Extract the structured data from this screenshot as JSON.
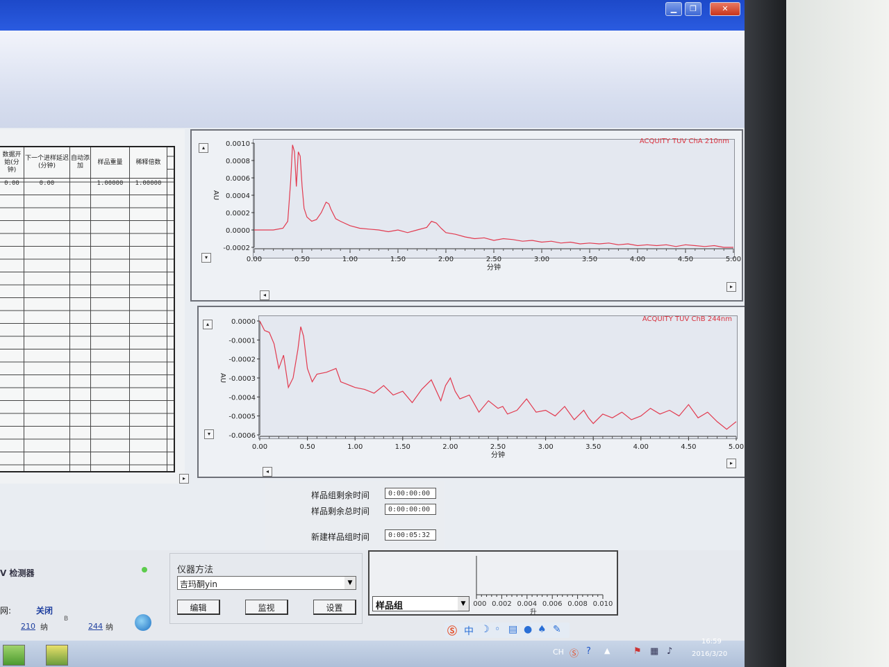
{
  "window": {
    "minimize_symbol": "▁",
    "restore_symbol": "❐",
    "close_symbol": "✕"
  },
  "table": {
    "headers": [
      "数据开始(分钟)",
      "下一个进样延迟(分钟)",
      "自动添加",
      "样品重量",
      "稀释倍数"
    ],
    "row1": [
      "0.00",
      "0.00",
      "",
      "1.00000",
      "1.00000"
    ]
  },
  "charts": [
    {
      "title": "ACQUITY TUV ChA 210nm",
      "ylabel": "AU",
      "xlabel": "分钟",
      "yticks": [
        "0.0010",
        "0.0008",
        "0.0006",
        "0.0004",
        "0.0002",
        "0.0000",
        "-0.0002"
      ],
      "xticks": [
        "0.00",
        "0.50",
        "1.00",
        "1.50",
        "2.00",
        "2.50",
        "3.00",
        "3.50",
        "4.00",
        "4.50",
        "5.00"
      ]
    },
    {
      "title": "ACQUITY TUV ChB 244nm",
      "ylabel": "AU",
      "xlabel": "分钟",
      "yticks": [
        "0.0000",
        "-0.0001",
        "-0.0002",
        "-0.0003",
        "-0.0004",
        "-0.0005",
        "-0.0006"
      ],
      "xticks": [
        "0.00",
        "0.50",
        "1.00",
        "1.50",
        "2.00",
        "2.50",
        "3.00",
        "3.50",
        "4.00",
        "4.50",
        "5.00"
      ]
    }
  ],
  "chart_data": [
    {
      "type": "line",
      "title": "ACQUITY TUV ChA 210nm",
      "xlabel": "分钟",
      "ylabel": "AU",
      "xlim": [
        0,
        5
      ],
      "ylim": [
        -0.0002,
        0.001
      ],
      "series": [
        {
          "color": "#e23a4f",
          "x": [
            0.0,
            0.2,
            0.3,
            0.35,
            0.38,
            0.4,
            0.42,
            0.44,
            0.46,
            0.48,
            0.5,
            0.52,
            0.55,
            0.6,
            0.65,
            0.7,
            0.75,
            0.78,
            0.8,
            0.85,
            0.9,
            1.0,
            1.1,
            1.2,
            1.3,
            1.4,
            1.5,
            1.6,
            1.7,
            1.8,
            1.85,
            1.9,
            1.95,
            2.0,
            2.1,
            2.2,
            2.3,
            2.4,
            2.5,
            2.6,
            2.7,
            2.8,
            2.9,
            3.0,
            3.1,
            3.2,
            3.3,
            3.4,
            3.5,
            3.6,
            3.7,
            3.8,
            3.9,
            4.0,
            4.1,
            4.2,
            4.3,
            4.4,
            4.5,
            4.6,
            4.7,
            4.8,
            4.9,
            5.0
          ],
          "values": [
            0.0,
            0.0,
            2e-05,
            0.0001,
            0.00055,
            0.00098,
            0.0009,
            0.0005,
            0.0009,
            0.00085,
            0.0005,
            0.00025,
            0.00015,
            0.0001,
            0.00012,
            0.0002,
            0.00032,
            0.0003,
            0.00024,
            0.00013,
            0.0001,
            5e-05,
            2e-05,
            1e-05,
            0.0,
            -2e-05,
            0.0,
            -3e-05,
            0.0,
            3e-05,
            0.0001,
            8e-05,
            2e-05,
            -3e-05,
            -5e-05,
            -8e-05,
            -0.0001,
            -9e-05,
            -0.00012,
            -0.0001,
            -0.00011,
            -0.00013,
            -0.00012,
            -0.00014,
            -0.00013,
            -0.00015,
            -0.00014,
            -0.00016,
            -0.00015,
            -0.00016,
            -0.00015,
            -0.00017,
            -0.00016,
            -0.00018,
            -0.00017,
            -0.00018,
            -0.00017,
            -0.00019,
            -0.00017,
            -0.00018,
            -0.00019,
            -0.00018,
            -0.0002,
            -0.0002
          ]
        }
      ]
    },
    {
      "type": "line",
      "title": "ACQUITY TUV ChB 244nm",
      "xlabel": "分钟",
      "ylabel": "AU",
      "xlim": [
        0,
        5
      ],
      "ylim": [
        -0.0006,
        0.0
      ],
      "series": [
        {
          "color": "#e23a4f",
          "x": [
            0.0,
            0.05,
            0.1,
            0.15,
            0.2,
            0.25,
            0.3,
            0.35,
            0.4,
            0.43,
            0.46,
            0.5,
            0.55,
            0.6,
            0.7,
            0.8,
            0.85,
            0.9,
            1.0,
            1.1,
            1.2,
            1.3,
            1.4,
            1.5,
            1.6,
            1.7,
            1.8,
            1.9,
            1.95,
            2.0,
            2.05,
            2.1,
            2.2,
            2.3,
            2.4,
            2.5,
            2.55,
            2.6,
            2.7,
            2.8,
            2.9,
            3.0,
            3.1,
            3.2,
            3.3,
            3.4,
            3.45,
            3.5,
            3.6,
            3.7,
            3.8,
            3.9,
            4.0,
            4.1,
            4.2,
            4.3,
            4.4,
            4.5,
            4.6,
            4.7,
            4.8,
            4.9,
            4.95,
            5.0
          ],
          "values": [
            0.0,
            -5e-05,
            -6e-05,
            -0.00012,
            -0.00025,
            -0.00018,
            -0.00035,
            -0.0003,
            -0.00015,
            -3e-05,
            -8e-05,
            -0.00025,
            -0.00032,
            -0.00028,
            -0.00027,
            -0.00025,
            -0.00032,
            -0.00033,
            -0.00035,
            -0.00036,
            -0.00038,
            -0.00034,
            -0.00039,
            -0.00037,
            -0.00043,
            -0.00036,
            -0.00031,
            -0.00042,
            -0.00034,
            -0.0003,
            -0.00037,
            -0.00041,
            -0.00039,
            -0.00048,
            -0.00042,
            -0.00046,
            -0.00045,
            -0.00049,
            -0.00047,
            -0.00041,
            -0.00048,
            -0.00047,
            -0.0005,
            -0.00045,
            -0.00052,
            -0.00047,
            -0.00051,
            -0.00054,
            -0.00049,
            -0.00051,
            -0.00048,
            -0.00052,
            -0.0005,
            -0.00046,
            -0.00049,
            -0.00047,
            -0.0005,
            -0.00044,
            -0.00051,
            -0.00048,
            -0.00053,
            -0.00057,
            -0.00055,
            -0.00053
          ]
        }
      ]
    }
  ],
  "status": {
    "sample_group_remaining_label": "样品组剩余时间",
    "sample_group_remaining_value": "0:00:00:00",
    "sample_remaining_total_label": "样品剩余总时间",
    "sample_remaining_total_value": "0:00:00:00",
    "new_sample_group_label": "新建样品组时间",
    "new_sample_group_value": "0:00:05:32"
  },
  "detector": {
    "title": "V 检测器",
    "lamp_label": "关闭",
    "row_prefix": "网:",
    "ch_b_prefix": "B",
    "wavelength_a": "210",
    "wavelength_b": "244",
    "unit": "纳"
  },
  "instrument": {
    "label": "仪器方法",
    "selected": "吉玛酮yin",
    "edit_btn": "编辑",
    "monitor_btn": "监视",
    "settings_btn": "设置"
  },
  "samplegroup": {
    "selected": "样品组",
    "xticks": [
      "0.000",
      "0.002",
      "0.004",
      "0.006",
      "0.008",
      "0.010"
    ],
    "unit": "升"
  },
  "ime": {
    "lang": "中"
  },
  "taskbar": {
    "lang": "CH",
    "time": "16:59",
    "date": "2016/3/20"
  }
}
